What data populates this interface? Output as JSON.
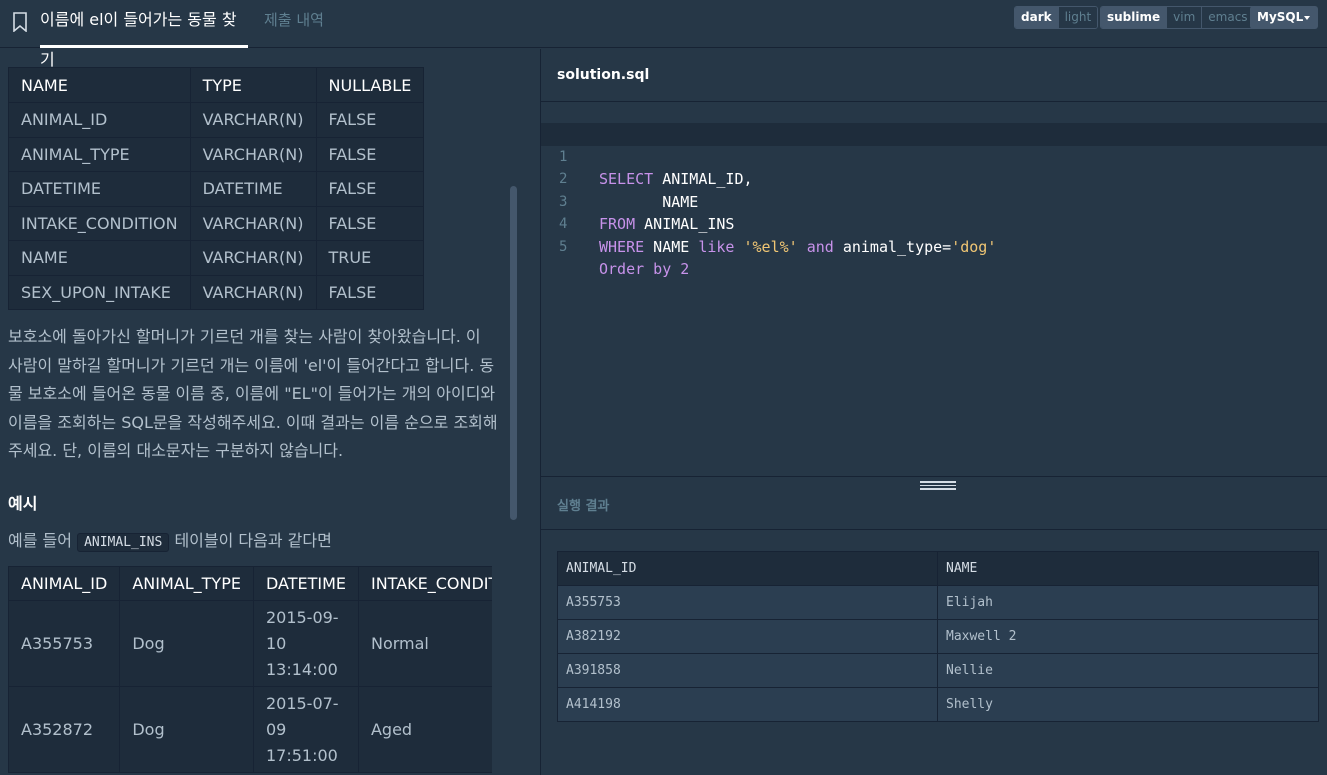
{
  "header": {
    "active_tab": "이름에 el이 들어가는 동물 찾기",
    "history_tab": "제출 내역",
    "themes": [
      "dark",
      "light"
    ],
    "keymaps": [
      "sublime",
      "vim",
      "emacs"
    ],
    "language": "MySQL"
  },
  "schema_table": {
    "headers": [
      "NAME",
      "TYPE",
      "NULLABLE"
    ],
    "rows": [
      [
        "ANIMAL_ID",
        "VARCHAR(N)",
        "FALSE"
      ],
      [
        "ANIMAL_TYPE",
        "VARCHAR(N)",
        "FALSE"
      ],
      [
        "DATETIME",
        "DATETIME",
        "FALSE"
      ],
      [
        "INTAKE_CONDITION",
        "VARCHAR(N)",
        "FALSE"
      ],
      [
        "NAME",
        "VARCHAR(N)",
        "TRUE"
      ],
      [
        "SEX_UPON_INTAKE",
        "VARCHAR(N)",
        "FALSE"
      ]
    ]
  },
  "description": "보호소에 돌아가신 할머니가 기르던 개를 찾는 사람이 찾아왔습니다. 이 사람이 말하길 할머니가 기르던 개는 이름에 'el'이 들어간다고 합니다. 동물 보호소에 들어온 동물 이름 중, 이름에 \"EL\"이 들어가는 개의 아이디와 이름을 조회하는 SQL문을 작성해주세요. 이때 결과는 이름 순으로 조회해주세요. 단, 이름의 대소문자는 구분하지 않습니다.",
  "example": {
    "heading": "예시",
    "intro_before": "예를 들어",
    "intro_code": "ANIMAL_INS",
    "intro_after": "테이블이 다음과 같다면",
    "headers": [
      "ANIMAL_ID",
      "ANIMAL_TYPE",
      "DATETIME",
      "INTAKE_CONDITIO"
    ],
    "rows": [
      [
        "A355753",
        "Dog",
        "2015-09-10 13:14:00",
        "Normal"
      ],
      [
        "A352872",
        "Dog",
        "2015-07-09 17:51:00",
        "Aged"
      ]
    ]
  },
  "editor": {
    "file_name": "solution.sql",
    "line_numbers": [
      "1",
      "2",
      "3",
      "4",
      "5"
    ],
    "tokens": {
      "l1_kw": "SELECT",
      "l1_rest": " ANIMAL_ID,",
      "l2": "       NAME",
      "l3_kw": "FROM",
      "l3_rest": " ANIMAL_INS",
      "l4_kw1": "WHERE",
      "l4_a": " NAME ",
      "l4_kw2": "like",
      "l4_str1": "'%el%'",
      "l4_kw3": "and",
      "l4_b": " animal_type=",
      "l4_str2": "'dog'",
      "l5_kw": "Order by",
      "l5_num": "2"
    }
  },
  "result": {
    "title": "실행 결과",
    "headers": [
      "ANIMAL_ID",
      "NAME"
    ],
    "rows": [
      [
        "A355753",
        "Elijah"
      ],
      [
        "A382192",
        "Maxwell 2"
      ],
      [
        "A391858",
        "Nellie"
      ],
      [
        "A414198",
        "Shelly"
      ]
    ]
  },
  "colors": {
    "background": "#263747",
    "keyword": "#c792ea",
    "string": "#f0c674"
  }
}
